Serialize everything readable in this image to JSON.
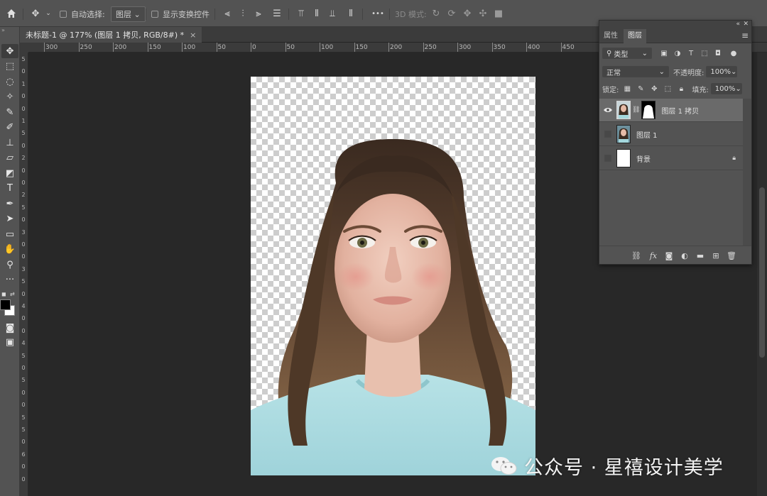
{
  "options_bar": {
    "auto_select_label": "自动选择:",
    "auto_select_target": "图层",
    "show_transform_label": "显示变换控件",
    "mode_3d_label": "3D 模式:",
    "more_label": "•••"
  },
  "document_tab": {
    "title": "未标题-1 @ 177% (图层 1 拷贝, RGB/8#) *",
    "close": "×"
  },
  "ruler": {
    "h_labels": [
      "300",
      "250",
      "200",
      "150",
      "100",
      "50",
      "0",
      "50",
      "100",
      "150",
      "200",
      "250",
      "300",
      "350",
      "400",
      "450"
    ],
    "v_labels": [
      "5",
      "0",
      "1",
      "0",
      "0",
      "1",
      "5",
      "0",
      "2",
      "0",
      "0",
      "2",
      "5",
      "0",
      "3",
      "0",
      "0",
      "3",
      "5",
      "0",
      "4",
      "0",
      "0",
      "4",
      "5",
      "0",
      "5",
      "0",
      "0",
      "5",
      "5",
      "0",
      "6",
      "0",
      "0"
    ]
  },
  "toolbar": {
    "tools": [
      {
        "name": "move-tool",
        "icon": "move-icon",
        "glyph": "✥"
      },
      {
        "name": "marquee-tool",
        "icon": "marquee-icon",
        "glyph": "⬚"
      },
      {
        "name": "lasso-tool",
        "icon": "lasso-icon",
        "glyph": "◌"
      },
      {
        "name": "magic-wand-tool",
        "icon": "magic-wand-icon",
        "glyph": "✧"
      },
      {
        "name": "eyedropper-tool",
        "icon": "eyedropper-icon",
        "glyph": "✎"
      },
      {
        "name": "brush-tool",
        "icon": "brush-icon",
        "glyph": "✐"
      },
      {
        "name": "stamp-tool",
        "icon": "stamp-icon",
        "glyph": "⊥"
      },
      {
        "name": "eraser-tool",
        "icon": "eraser-icon",
        "glyph": "▱"
      },
      {
        "name": "bucket-tool",
        "icon": "bucket-icon",
        "glyph": "◩"
      },
      {
        "name": "type-tool",
        "icon": "type-icon",
        "glyph": "T"
      },
      {
        "name": "pen-tool",
        "icon": "pen-icon",
        "glyph": "✒"
      },
      {
        "name": "path-select-tool",
        "icon": "arrow-icon",
        "glyph": "➤"
      },
      {
        "name": "shape-tool",
        "icon": "rectangle-icon",
        "glyph": "▭"
      },
      {
        "name": "hand-tool",
        "icon": "hand-icon",
        "glyph": "✋"
      },
      {
        "name": "zoom-tool",
        "icon": "zoom-icon",
        "glyph": "⚲"
      },
      {
        "name": "more-tools",
        "icon": "ellipsis-icon",
        "glyph": "···"
      }
    ]
  },
  "layers_panel": {
    "tabs": [
      "属性",
      "图层"
    ],
    "active_tab": "图层",
    "kind_filter": "类型",
    "blend_mode": "正常",
    "opacity_label": "不透明度:",
    "opacity_value": "100%",
    "lock_label": "锁定:",
    "fill_label": "填充:",
    "fill_value": "100%",
    "layers": [
      {
        "name": "图层 1 拷贝",
        "visible": true,
        "selected": true,
        "has_mask": true
      },
      {
        "name": "图层 1",
        "visible": false,
        "selected": false,
        "has_mask": false
      },
      {
        "name": "背景",
        "visible": false,
        "selected": false,
        "has_mask": false,
        "locked": true
      }
    ]
  },
  "watermark": {
    "text": "公众号 · 星禧设计美学"
  },
  "colors": {
    "ui_panel": "#535353",
    "canvas_bg": "#282828",
    "selected_layer": "#6a6a6a",
    "shirt": "#a9dbe0"
  }
}
